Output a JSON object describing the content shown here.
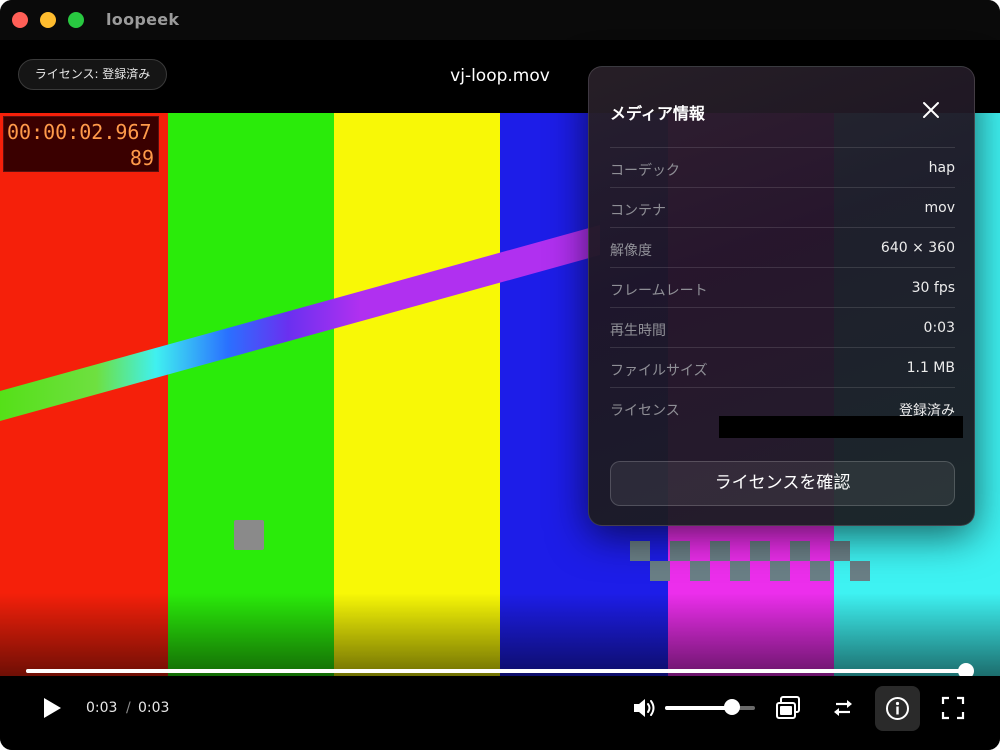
{
  "app": {
    "name": "loopeek"
  },
  "header": {
    "license_badge": "ライセンス: 登録済み",
    "file_name": "vj-loop.mov"
  },
  "overlay": {
    "timecode": "00:00:02.967",
    "frame": "89"
  },
  "playback": {
    "current": "0:03",
    "separator": "/",
    "total": "0:03",
    "progress": 1.0,
    "volume": 0.75
  },
  "info_panel": {
    "title": "メディア情報",
    "rows": [
      {
        "label": "コーデック",
        "value": "hap"
      },
      {
        "label": "コンテナ",
        "value": "mov"
      },
      {
        "label": "解像度",
        "value": "640 × 360"
      },
      {
        "label": "フレームレート",
        "value": "30 fps"
      },
      {
        "label": "再生時間",
        "value": "0:03"
      },
      {
        "label": "ファイルサイズ",
        "value": "1.1 MB"
      },
      {
        "label": "ライセンス",
        "value": "登録済み"
      }
    ],
    "verify_button": "ライセンスを確認"
  },
  "colors": {
    "bar_red": "#f5200a",
    "bar_green": "#2aeb0a",
    "bar_yellow": "#f8f806",
    "bar_blue": "#1d1de8",
    "bar_magenta": "#ec2eec",
    "bar_cyan": "#3ef2f2",
    "accent_white": "#ffffff"
  },
  "icons": [
    "play-icon",
    "volume-icon",
    "pip-icon",
    "loop-icon",
    "info-icon",
    "fullscreen-icon",
    "close-icon"
  ]
}
